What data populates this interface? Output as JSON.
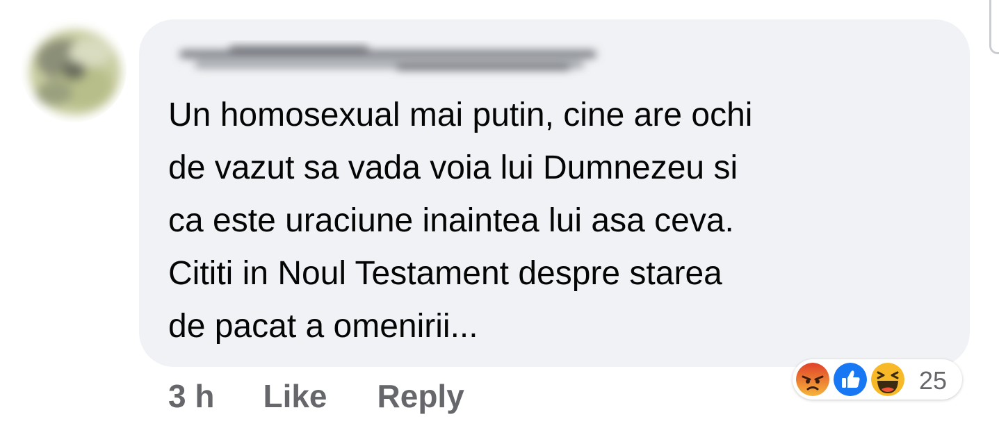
{
  "comment": {
    "author_name": "",
    "text_lines": [
      "Un homosexual mai putin, cine are ochi",
      "de vazut sa vada voia lui Dumnezeu si",
      "ca este uraciune inaintea lui asa ceva.",
      "Cititi in Noul Testament despre starea",
      "de pacat a omenirii..."
    ],
    "avatar_icon": "blurred-profile-photo",
    "bubble_color": "#f0f2f5",
    "text_color": "#050505"
  },
  "actions": {
    "timestamp": "3 h",
    "like_label": "Like",
    "reply_label": "Reply",
    "color": "#65676b"
  },
  "reactions": {
    "icons": [
      "angry-reaction-icon",
      "like-reaction-icon",
      "haha-reaction-icon"
    ],
    "count": "25",
    "colors": {
      "angry": "#f0552a",
      "like": "#1877f2",
      "haha": "#f7b928"
    }
  }
}
